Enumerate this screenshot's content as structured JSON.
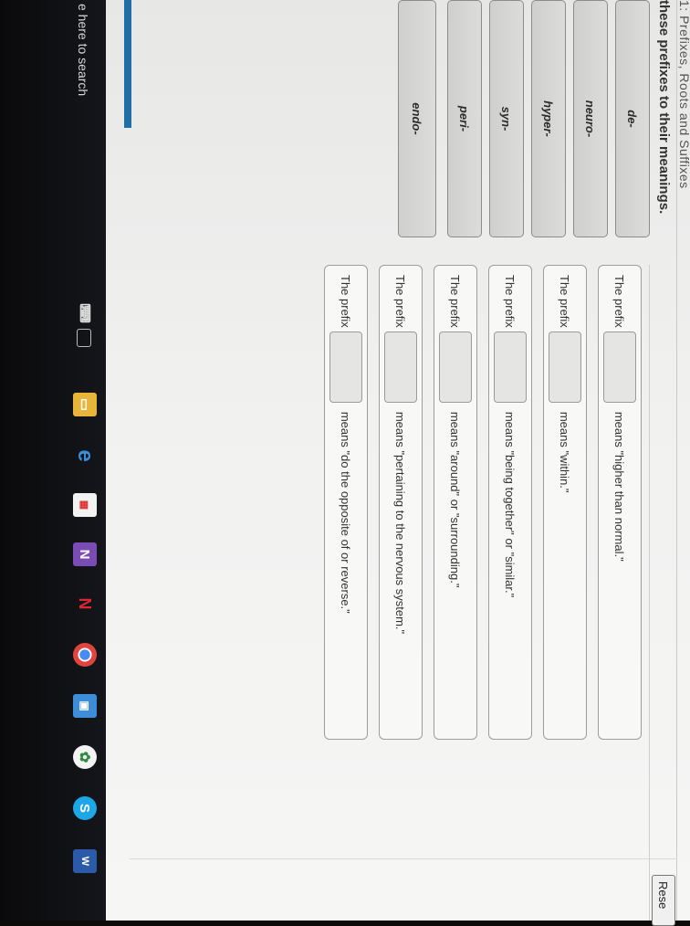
{
  "page": {
    "header_partial": "1: Prefixes, Roots and Suffixes",
    "instruction": "these prefixes to their meanings.",
    "reset_label": "Rese"
  },
  "prefix_bank": [
    "de-",
    "neuro-",
    "hyper-",
    "syn-",
    "peri-",
    "endo-"
  ],
  "questions": [
    {
      "prefix_text": "The prefix",
      "meaning": "means \"higher than normal.\""
    },
    {
      "prefix_text": "The prefix",
      "meaning": "means \"within.\""
    },
    {
      "prefix_text": "The prefix",
      "meaning": "means \"being together\" or \"similar.\""
    },
    {
      "prefix_text": "The prefix",
      "meaning": "means \"around\" or \"surrounding.\""
    },
    {
      "prefix_text": "The prefix",
      "meaning": "means \"pertaining to the nervous system.\""
    },
    {
      "prefix_text": "The prefix",
      "meaning": "means \"do the opposite of or reverse.\""
    }
  ],
  "taskbar": {
    "search_text": "e here to search",
    "icons": [
      "microphone-icon",
      "task-view-icon",
      "file-explorer-icon",
      "edge-icon",
      "store-icon",
      "onenote-icon",
      "netflix-icon",
      "chrome-icon",
      "photos-icon",
      "paint-icon",
      "skype-icon",
      "word-icon"
    ]
  },
  "colors": {
    "taskbar": "#0c0b0a",
    "accent": "#1f6fa6"
  }
}
